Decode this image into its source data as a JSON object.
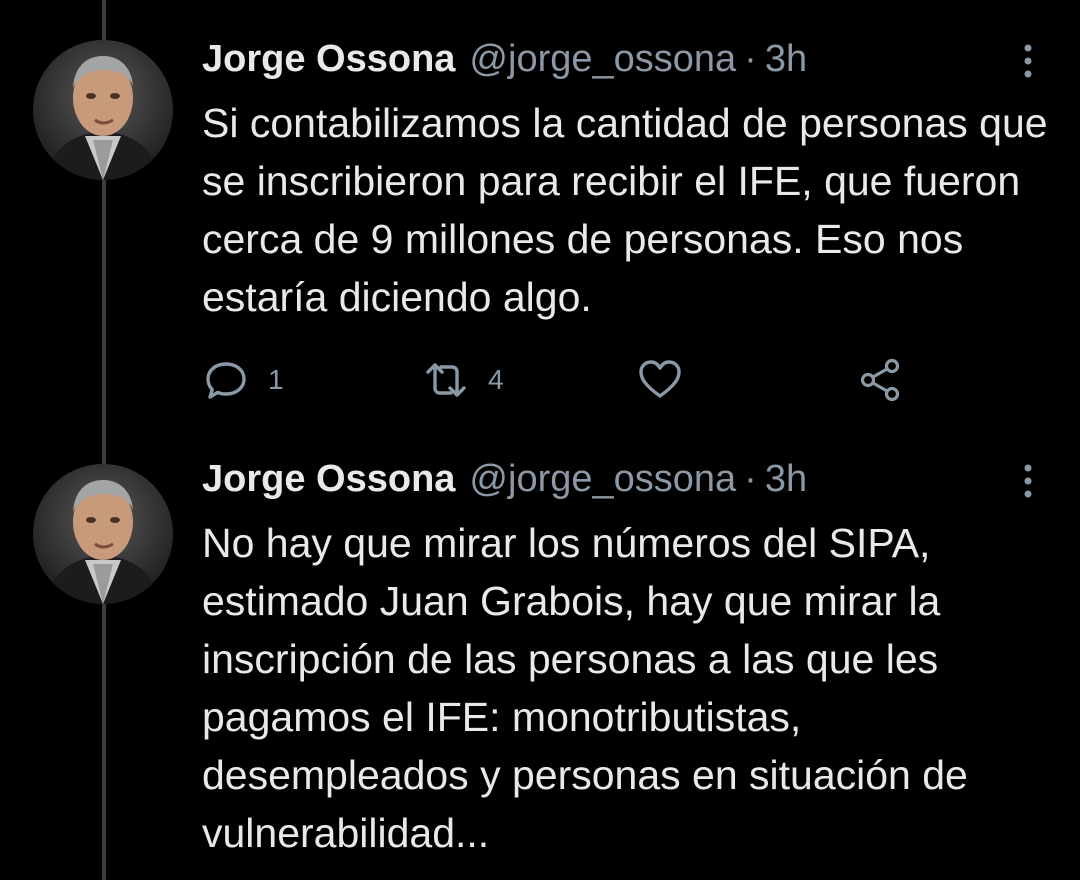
{
  "tweets": [
    {
      "author": {
        "display_name": "Jorge Ossona",
        "handle": "@jorge_ossona",
        "avatar_icon": "profile-photo"
      },
      "separator": "·",
      "time": "3h",
      "text": "Si contabilizamos la cantidad de personas que se inscribieron para recibir el IFE, que fueron cerca de 9 millones de personas. Eso nos estaría diciendo algo.",
      "actions": {
        "reply_count": "1",
        "retweet_count": "4"
      }
    },
    {
      "author": {
        "display_name": "Jorge Ossona",
        "handle": "@jorge_ossona",
        "avatar_icon": "profile-photo"
      },
      "separator": "·",
      "time": "3h",
      "text": "No hay que mirar los números del SIPA, estimado Juan Grabois, hay que mirar la inscripción de las personas a las que les pagamos el IFE: monotributistas, desempleados y personas en situación de vulnerabilidad..."
    }
  ],
  "icons": {
    "reply": "reply-icon",
    "retweet": "retweet-icon",
    "like": "heart-icon",
    "share": "share-icon",
    "more": "more-vertical-icon"
  },
  "colors": {
    "background": "#000000",
    "primary_text": "#e7e9ea",
    "secondary_text": "#8b98a5",
    "thread_line": "#3a3f44"
  }
}
